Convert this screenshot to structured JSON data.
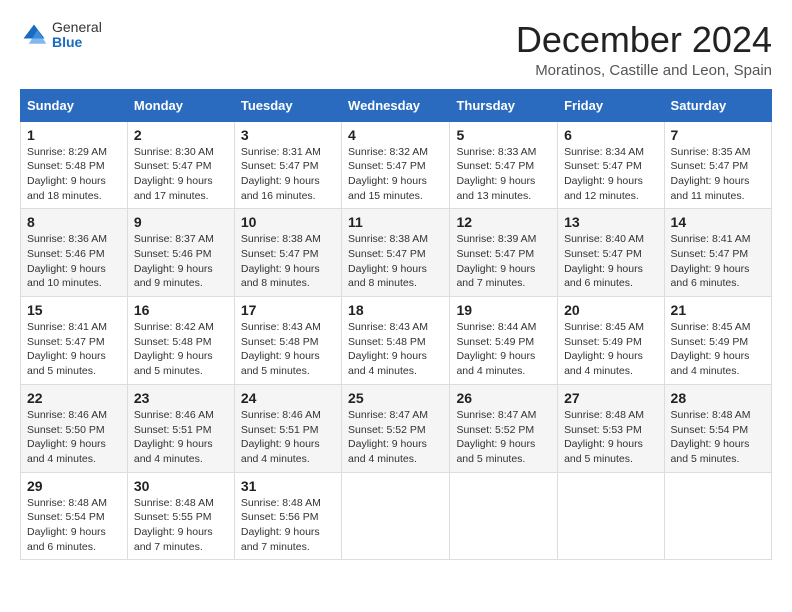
{
  "logo": {
    "general": "General",
    "blue": "Blue"
  },
  "header": {
    "month": "December 2024",
    "location": "Moratinos, Castille and Leon, Spain"
  },
  "weekdays": [
    "Sunday",
    "Monday",
    "Tuesday",
    "Wednesday",
    "Thursday",
    "Friday",
    "Saturday"
  ],
  "weeks": [
    [
      {
        "day": "1",
        "sunrise": "8:29 AM",
        "sunset": "5:48 PM",
        "daylight": "9 hours and 18 minutes."
      },
      {
        "day": "2",
        "sunrise": "8:30 AM",
        "sunset": "5:47 PM",
        "daylight": "9 hours and 17 minutes."
      },
      {
        "day": "3",
        "sunrise": "8:31 AM",
        "sunset": "5:47 PM",
        "daylight": "9 hours and 16 minutes."
      },
      {
        "day": "4",
        "sunrise": "8:32 AM",
        "sunset": "5:47 PM",
        "daylight": "9 hours and 15 minutes."
      },
      {
        "day": "5",
        "sunrise": "8:33 AM",
        "sunset": "5:47 PM",
        "daylight": "9 hours and 13 minutes."
      },
      {
        "day": "6",
        "sunrise": "8:34 AM",
        "sunset": "5:47 PM",
        "daylight": "9 hours and 12 minutes."
      },
      {
        "day": "7",
        "sunrise": "8:35 AM",
        "sunset": "5:47 PM",
        "daylight": "9 hours and 11 minutes."
      }
    ],
    [
      {
        "day": "8",
        "sunrise": "8:36 AM",
        "sunset": "5:46 PM",
        "daylight": "9 hours and 10 minutes."
      },
      {
        "day": "9",
        "sunrise": "8:37 AM",
        "sunset": "5:46 PM",
        "daylight": "9 hours and 9 minutes."
      },
      {
        "day": "10",
        "sunrise": "8:38 AM",
        "sunset": "5:47 PM",
        "daylight": "9 hours and 8 minutes."
      },
      {
        "day": "11",
        "sunrise": "8:38 AM",
        "sunset": "5:47 PM",
        "daylight": "9 hours and 8 minutes."
      },
      {
        "day": "12",
        "sunrise": "8:39 AM",
        "sunset": "5:47 PM",
        "daylight": "9 hours and 7 minutes."
      },
      {
        "day": "13",
        "sunrise": "8:40 AM",
        "sunset": "5:47 PM",
        "daylight": "9 hours and 6 minutes."
      },
      {
        "day": "14",
        "sunrise": "8:41 AM",
        "sunset": "5:47 PM",
        "daylight": "9 hours and 6 minutes."
      }
    ],
    [
      {
        "day": "15",
        "sunrise": "8:41 AM",
        "sunset": "5:47 PM",
        "daylight": "9 hours and 5 minutes."
      },
      {
        "day": "16",
        "sunrise": "8:42 AM",
        "sunset": "5:48 PM",
        "daylight": "9 hours and 5 minutes."
      },
      {
        "day": "17",
        "sunrise": "8:43 AM",
        "sunset": "5:48 PM",
        "daylight": "9 hours and 5 minutes."
      },
      {
        "day": "18",
        "sunrise": "8:43 AM",
        "sunset": "5:48 PM",
        "daylight": "9 hours and 4 minutes."
      },
      {
        "day": "19",
        "sunrise": "8:44 AM",
        "sunset": "5:49 PM",
        "daylight": "9 hours and 4 minutes."
      },
      {
        "day": "20",
        "sunrise": "8:45 AM",
        "sunset": "5:49 PM",
        "daylight": "9 hours and 4 minutes."
      },
      {
        "day": "21",
        "sunrise": "8:45 AM",
        "sunset": "5:49 PM",
        "daylight": "9 hours and 4 minutes."
      }
    ],
    [
      {
        "day": "22",
        "sunrise": "8:46 AM",
        "sunset": "5:50 PM",
        "daylight": "9 hours and 4 minutes."
      },
      {
        "day": "23",
        "sunrise": "8:46 AM",
        "sunset": "5:51 PM",
        "daylight": "9 hours and 4 minutes."
      },
      {
        "day": "24",
        "sunrise": "8:46 AM",
        "sunset": "5:51 PM",
        "daylight": "9 hours and 4 minutes."
      },
      {
        "day": "25",
        "sunrise": "8:47 AM",
        "sunset": "5:52 PM",
        "daylight": "9 hours and 4 minutes."
      },
      {
        "day": "26",
        "sunrise": "8:47 AM",
        "sunset": "5:52 PM",
        "daylight": "9 hours and 5 minutes."
      },
      {
        "day": "27",
        "sunrise": "8:48 AM",
        "sunset": "5:53 PM",
        "daylight": "9 hours and 5 minutes."
      },
      {
        "day": "28",
        "sunrise": "8:48 AM",
        "sunset": "5:54 PM",
        "daylight": "9 hours and 5 minutes."
      }
    ],
    [
      {
        "day": "29",
        "sunrise": "8:48 AM",
        "sunset": "5:54 PM",
        "daylight": "9 hours and 6 minutes."
      },
      {
        "day": "30",
        "sunrise": "8:48 AM",
        "sunset": "5:55 PM",
        "daylight": "9 hours and 7 minutes."
      },
      {
        "day": "31",
        "sunrise": "8:48 AM",
        "sunset": "5:56 PM",
        "daylight": "9 hours and 7 minutes."
      },
      null,
      null,
      null,
      null
    ]
  ]
}
